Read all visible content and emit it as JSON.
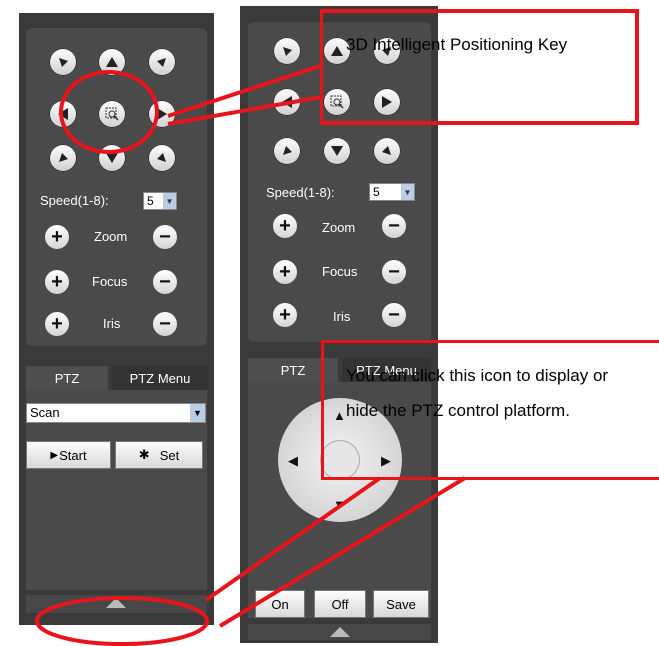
{
  "colors": {
    "panel": "#3a3a3a",
    "inner": "#4a4a4a",
    "annotation_red": "#e8141c"
  },
  "ptz": {
    "speed_label": "Speed(1-8):",
    "speed_value": "5",
    "zoom_label": "Zoom",
    "focus_label": "Focus",
    "iris_label": "Iris",
    "plus": "+",
    "minus": "−"
  },
  "tabs": {
    "ptz": "PTZ",
    "ptz_menu": "PTZ Menu"
  },
  "menu": {
    "scan_value": "Scan",
    "start_label": "Start",
    "set_label": "Set",
    "on_label": "On",
    "off_label": "Off",
    "save_label": "Save"
  },
  "annotations": {
    "positioning_key": "3D Intelligent Positioning Key",
    "toggle_note": "You can click this icon to display or hide the PTZ control platform."
  }
}
